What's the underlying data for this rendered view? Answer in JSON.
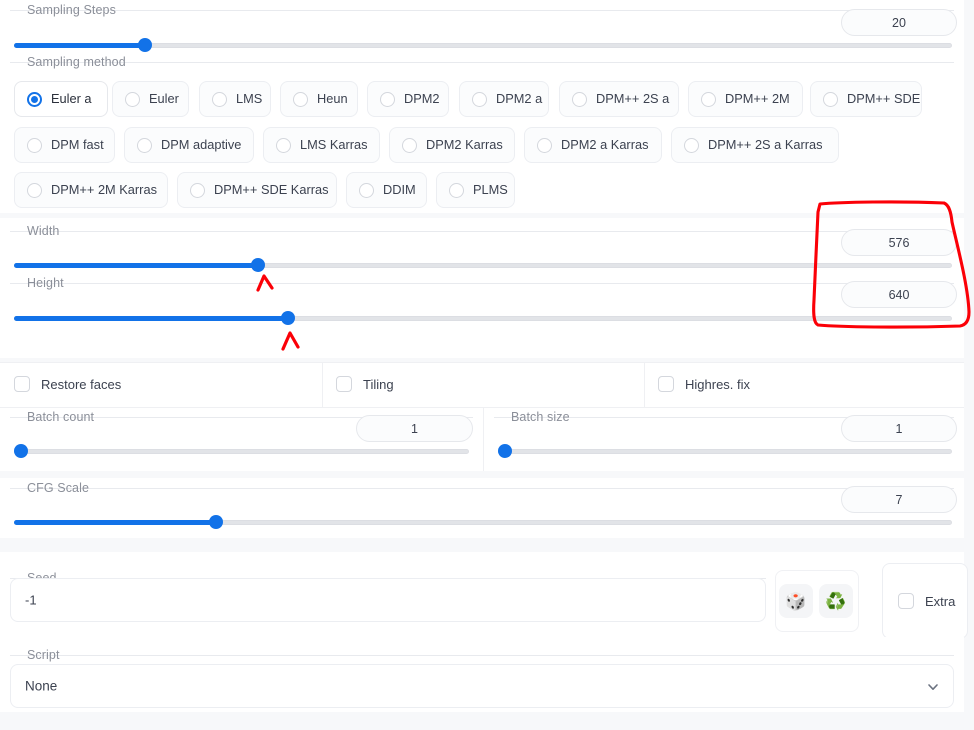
{
  "app": {
    "background": "#f7f8fa",
    "accent": "#1272e8",
    "annotation_color": "#fb0007"
  },
  "sampling_steps": {
    "label": "Sampling Steps",
    "value": "20",
    "slider_fill_pct": 14.0
  },
  "sampling_method": {
    "label": "Sampling method",
    "selected": "Euler a",
    "options": [
      "Euler a",
      "Euler",
      "LMS",
      "Heun",
      "DPM2",
      "DPM2 a",
      "DPM++ 2S a",
      "DPM++ 2M",
      "DPM++ SDE",
      "DPM fast",
      "DPM adaptive",
      "LMS Karras",
      "DPM2 Karras",
      "DPM2 a Karras",
      "DPM++ 2S a Karras",
      "DPM++ 2M Karras",
      "DPM++ SDE Karras",
      "DDIM",
      "PLMS"
    ]
  },
  "width": {
    "label": "Width",
    "value": "576",
    "slider_fill_pct": 26.0
  },
  "height": {
    "label": "Height",
    "value": "640",
    "slider_fill_pct": 29.2
  },
  "toggles": {
    "restore_faces": {
      "label": "Restore faces",
      "checked": false
    },
    "tiling": {
      "label": "Tiling",
      "checked": false
    },
    "highres_fix": {
      "label": "Highres. fix",
      "checked": false
    }
  },
  "batch_count": {
    "label": "Batch count",
    "value": "1",
    "slider_fill_pct": 0.0
  },
  "batch_size": {
    "label": "Batch size",
    "value": "1",
    "slider_fill_pct": 0.0
  },
  "cfg_scale": {
    "label": "CFG Scale",
    "value": "7",
    "slider_fill_pct": 21.5
  },
  "seed": {
    "label": "Seed",
    "value": "-1",
    "placeholder": "-1",
    "random_icon": "dice-icon",
    "random_glyph": "🎲",
    "reuse_icon": "recycle-icon",
    "reuse_glyph": "♻️",
    "extra": {
      "label": "Extra",
      "checked": false
    }
  },
  "script": {
    "label": "Script",
    "value": "None",
    "chevron_icon": "chevron-down-icon"
  },
  "annotation": {
    "type": "hand-drawn",
    "shapes": [
      "rectangle-around-size-values",
      "caret-under-width-thumb",
      "caret-under-height-thumb"
    ]
  }
}
